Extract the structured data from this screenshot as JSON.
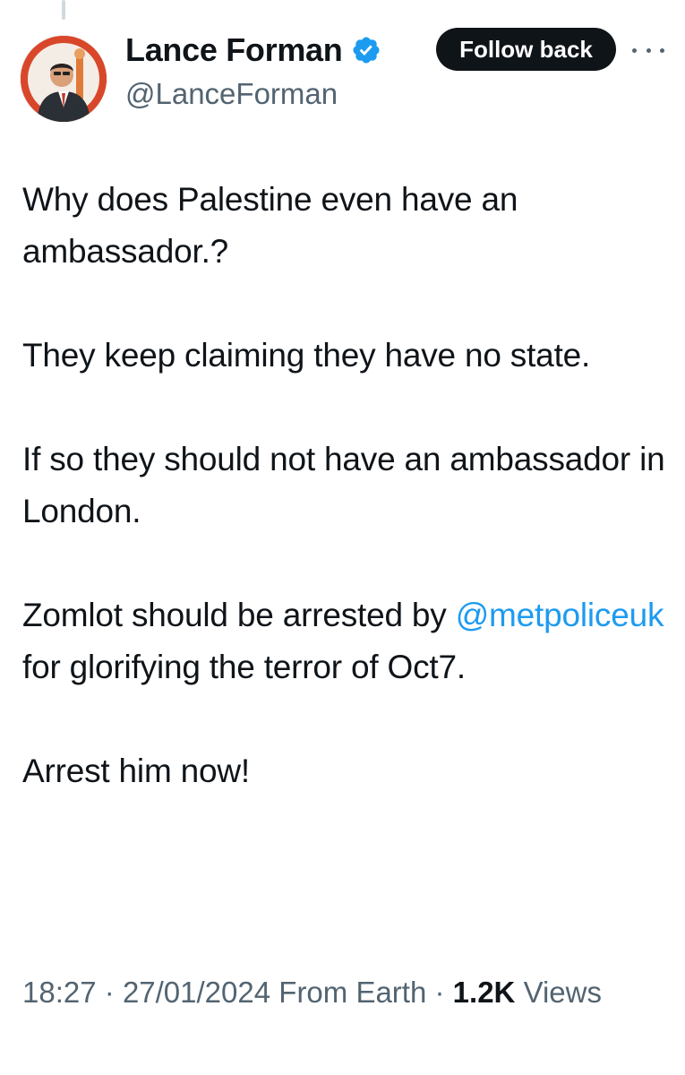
{
  "author": {
    "display_name": "Lance Forman",
    "handle": "@LanceForman",
    "verified": true
  },
  "follow_button_label": "Follow back",
  "more_icon": "more-horizontal-icon",
  "tweet": {
    "paragraph_1": "Why does Palestine even have an ambassador.?",
    "paragraph_2": "They keep claiming they have no state.",
    "paragraph_3": "If so they should not have an ambassador in London.",
    "paragraph_4_before": "Zomlot should be arrested by",
    "paragraph_4_mention": "@metpoliceuk",
    "paragraph_4_after": "for glorifying the terror of Oct7.",
    "paragraph_5": "Arrest him now!"
  },
  "meta": {
    "time": "18:27",
    "separator": "·",
    "date": "27/01/2024",
    "source": "From Earth",
    "views_count": "1.2K",
    "views_label": "Views"
  },
  "colors": {
    "link": "#1d9bf0",
    "text_primary": "#0f1419",
    "text_secondary": "#536471",
    "verified_badge": "#1d9bf0",
    "avatar_background": "#d9472a"
  }
}
